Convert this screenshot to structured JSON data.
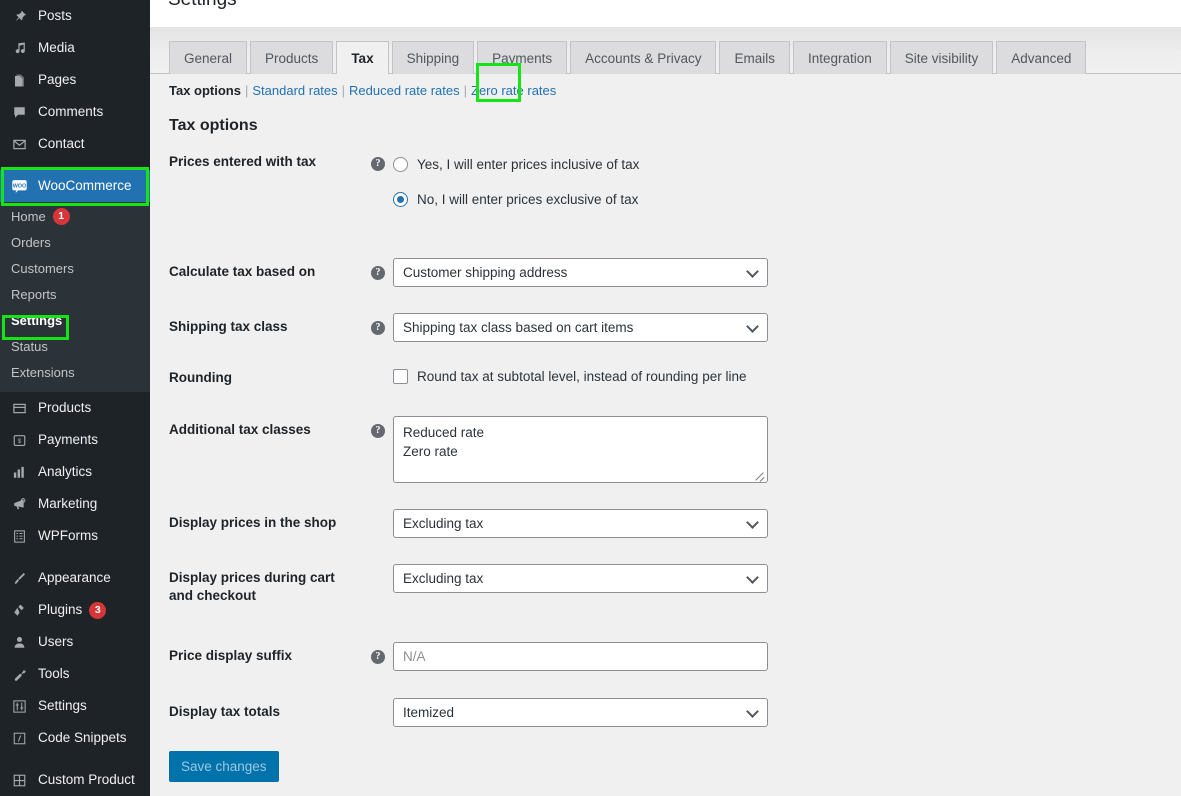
{
  "sidebar": {
    "items": [
      {
        "label": "Posts",
        "icon": "pin-icon",
        "id": "posts"
      },
      {
        "label": "Media",
        "icon": "music-note-icon",
        "id": "media"
      },
      {
        "label": "Pages",
        "icon": "page-icon",
        "id": "pages"
      },
      {
        "label": "Comments",
        "icon": "comment-icon",
        "id": "comments"
      },
      {
        "label": "Contact",
        "icon": "envelope-icon",
        "id": "contact"
      },
      {
        "label": "WooCommerce",
        "icon": "woo-icon",
        "id": "woocommerce",
        "current": true
      },
      {
        "label": "Products",
        "icon": "products-icon",
        "id": "products"
      },
      {
        "label": "Payments",
        "icon": "payments-icon",
        "id": "payments"
      },
      {
        "label": "Analytics",
        "icon": "bar-chart-icon",
        "id": "analytics"
      },
      {
        "label": "Marketing",
        "icon": "megaphone-icon",
        "id": "marketing"
      },
      {
        "label": "WPForms",
        "icon": "form-icon",
        "id": "wpforms"
      },
      {
        "label": "Appearance",
        "icon": "paintbrush-icon",
        "id": "appearance"
      },
      {
        "label": "Plugins",
        "icon": "plug-icon",
        "id": "plugins",
        "badge": "3"
      },
      {
        "label": "Users",
        "icon": "user-icon",
        "id": "users"
      },
      {
        "label": "Tools",
        "icon": "wrench-icon",
        "id": "tools"
      },
      {
        "label": "Settings",
        "icon": "sliders-icon",
        "id": "settings"
      },
      {
        "label": "Code Snippets",
        "icon": "code-icon",
        "id": "code-snippets"
      },
      {
        "label": "Custom Product",
        "icon": "grid-icon",
        "id": "custom-product"
      }
    ],
    "submenu": [
      {
        "label": "Home",
        "badge": "1"
      },
      {
        "label": "Orders"
      },
      {
        "label": "Customers"
      },
      {
        "label": "Reports"
      },
      {
        "label": "Settings",
        "active": true
      },
      {
        "label": "Status"
      },
      {
        "label": "Extensions"
      }
    ]
  },
  "header": {
    "title": "Settings"
  },
  "tabs": [
    {
      "label": "General"
    },
    {
      "label": "Products"
    },
    {
      "label": "Tax",
      "active": true
    },
    {
      "label": "Shipping"
    },
    {
      "label": "Payments"
    },
    {
      "label": "Accounts & Privacy"
    },
    {
      "label": "Emails"
    },
    {
      "label": "Integration"
    },
    {
      "label": "Site visibility"
    },
    {
      "label": "Advanced"
    }
  ],
  "subnav": {
    "current": "Tax options",
    "links": [
      "Standard rates",
      "Reduced rate rates",
      "Zero rate rates"
    ],
    "separator": "|"
  },
  "section": {
    "title": "Tax options"
  },
  "form": {
    "prices_entered_with_tax": {
      "label": "Prices entered with tax",
      "help": "?",
      "options": [
        {
          "text": "Yes, I will enter prices inclusive of tax",
          "checked": false
        },
        {
          "text": "No, I will enter prices exclusive of tax",
          "checked": true
        }
      ]
    },
    "calculate_tax_based_on": {
      "label": "Calculate tax based on",
      "help": "?",
      "value": "Customer shipping address"
    },
    "shipping_tax_class": {
      "label": "Shipping tax class",
      "help": "?",
      "value": "Shipping tax class based on cart items"
    },
    "rounding": {
      "label": "Rounding",
      "checkbox_label": "Round tax at subtotal level, instead of rounding per line",
      "checked": false
    },
    "additional_tax_classes": {
      "label": "Additional tax classes",
      "help": "?",
      "value": "Reduced rate\nZero rate"
    },
    "display_prices_shop": {
      "label": "Display prices in the shop",
      "value": "Excluding tax"
    },
    "display_prices_cart": {
      "label": "Display prices during cart and checkout",
      "value": "Excluding tax"
    },
    "price_display_suffix": {
      "label": "Price display suffix",
      "help": "?",
      "placeholder": "N/A",
      "value": "N/A"
    },
    "display_tax_totals": {
      "label": "Display tax totals",
      "value": "Itemized"
    }
  },
  "actions": {
    "save_label": "Save changes"
  },
  "colors": {
    "sidebar_bg": "#1d2327",
    "submenu_bg": "#2c3338",
    "accent_blue": "#2271b1",
    "highlight_green": "#16e416",
    "badge_red": "#d63638",
    "save_button": "#0272ab",
    "link_blue": "#2271b1"
  }
}
